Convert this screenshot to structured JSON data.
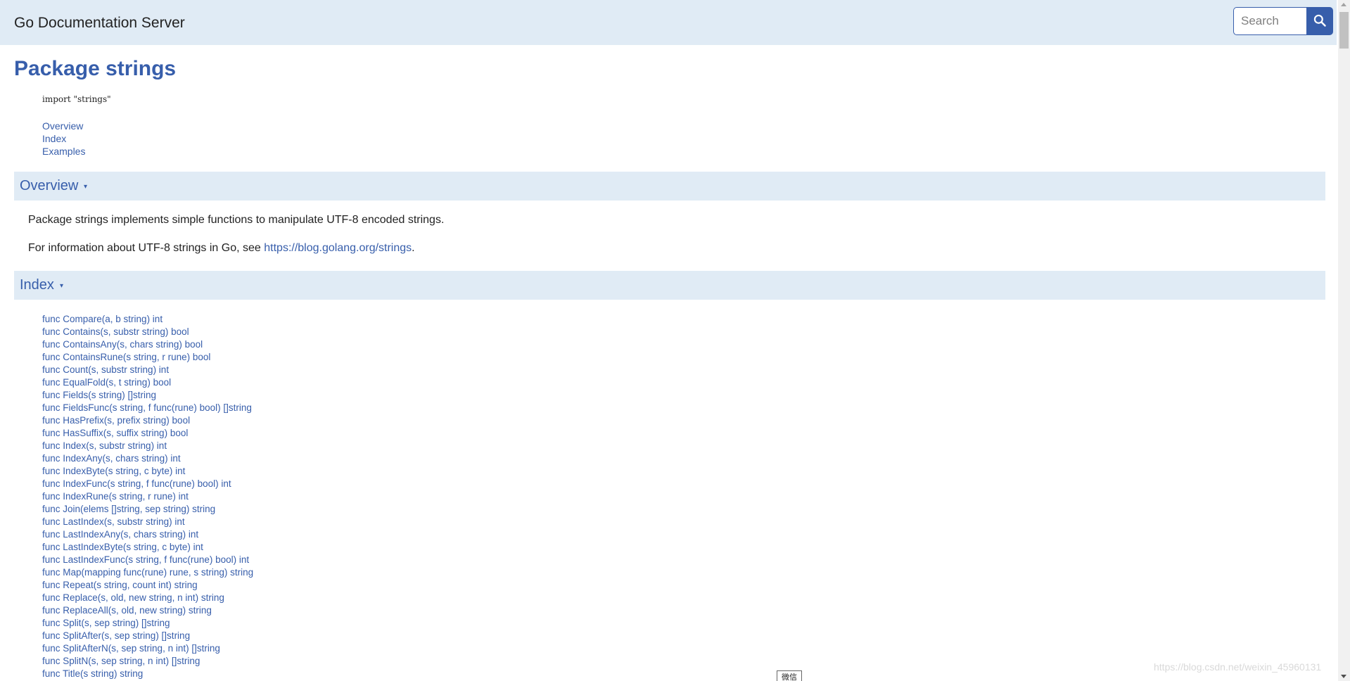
{
  "header": {
    "site_title": "Go Documentation Server",
    "search": {
      "placeholder": "Search",
      "value": "",
      "button_icon": "search-icon"
    }
  },
  "package": {
    "title": "Package strings",
    "import_line": "import \"strings\""
  },
  "toc": [
    "Overview",
    "Index",
    "Examples"
  ],
  "overview": {
    "heading": "Overview",
    "toggle": "▾",
    "para1": "Package strings implements simple functions to manipulate UTF-8 encoded strings.",
    "para2_prefix": "For information about UTF-8 strings in Go, see ",
    "para2_link": "https://blog.golang.org/strings",
    "para2_suffix": "."
  },
  "index": {
    "heading": "Index",
    "toggle": "▾",
    "items": [
      "func Compare(a, b string) int",
      "func Contains(s, substr string) bool",
      "func ContainsAny(s, chars string) bool",
      "func ContainsRune(s string, r rune) bool",
      "func Count(s, substr string) int",
      "func EqualFold(s, t string) bool",
      "func Fields(s string) []string",
      "func FieldsFunc(s string, f func(rune) bool) []string",
      "func HasPrefix(s, prefix string) bool",
      "func HasSuffix(s, suffix string) bool",
      "func Index(s, substr string) int",
      "func IndexAny(s, chars string) int",
      "func IndexByte(s string, c byte) int",
      "func IndexFunc(s string, f func(rune) bool) int",
      "func IndexRune(s string, r rune) int",
      "func Join(elems []string, sep string) string",
      "func LastIndex(s, substr string) int",
      "func LastIndexAny(s, chars string) int",
      "func LastIndexByte(s string, c byte) int",
      "func LastIndexFunc(s string, f func(rune) bool) int",
      "func Map(mapping func(rune) rune, s string) string",
      "func Repeat(s string, count int) string",
      "func Replace(s, old, new string, n int) string",
      "func ReplaceAll(s, old, new string) string",
      "func Split(s, sep string) []string",
      "func SplitAfter(s, sep string) []string",
      "func SplitAfterN(s, sep string, n int) []string",
      "func SplitN(s, sep string, n int) []string",
      "func Title(s string) string"
    ]
  },
  "overlay": {
    "watermark": "https://blog.csdn.net/weixin_45960131",
    "wechat_badge": "微信"
  },
  "colors": {
    "link": "#375eab",
    "header_bg": "#e0ebf5",
    "search_button": "#375eab"
  }
}
